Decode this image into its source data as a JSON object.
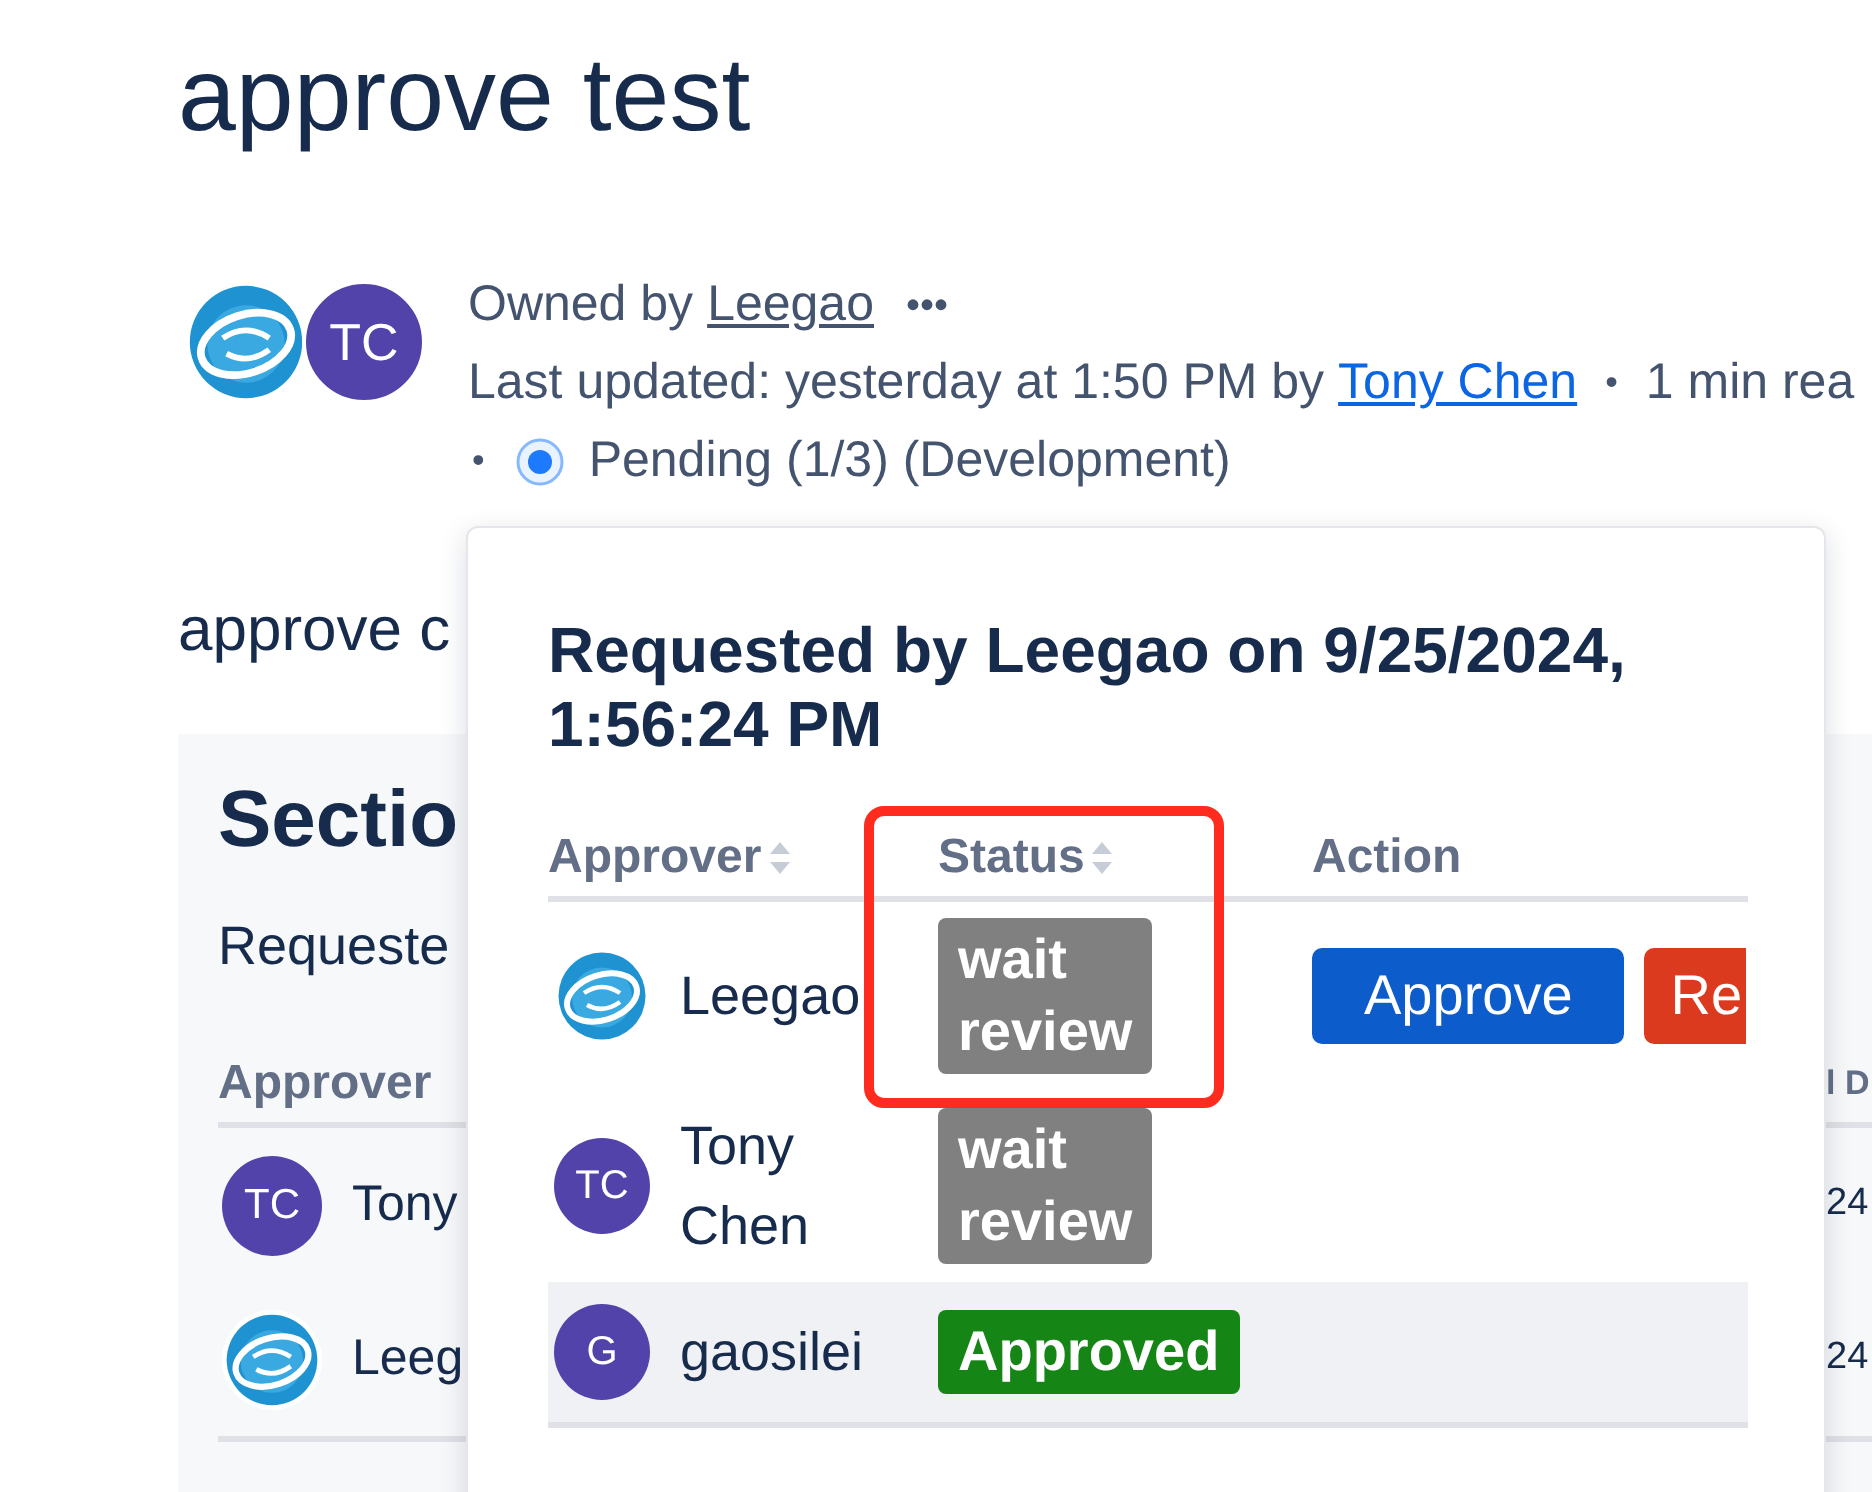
{
  "page_title": "approve test",
  "byline": {
    "avatars": [
      {
        "kind": "logo"
      },
      {
        "kind": "initials",
        "initials": "TC"
      }
    ],
    "owned_label": "Owned by",
    "owner": "Leegao",
    "more_button": "•••",
    "updated_text": "Last updated: yesterday at 1:50 PM by",
    "updated_by": "Tony Chen",
    "separator": "•",
    "read_time": "1 min rea",
    "status_separator": "•",
    "status": "Pending (1/3) (Development)"
  },
  "body_text": "approve c",
  "section": {
    "title": "Sectio",
    "subtitle": "Requeste",
    "columns": [
      "Approver",
      "l D"
    ],
    "rows": [
      {
        "avatar": {
          "kind": "initials",
          "initials": "TC"
        },
        "name": "Tony",
        "column_2": "24"
      },
      {
        "avatar": {
          "kind": "logo"
        },
        "name": "Leeg",
        "column_2": "24"
      }
    ]
  },
  "popover": {
    "title": "Requested by Leegao on 9/25/2024, 1:56:24 PM",
    "columns": [
      {
        "label": "Approver",
        "sortable": true
      },
      {
        "label": "Status",
        "sortable": true
      },
      {
        "label": "Action",
        "sortable": false
      }
    ],
    "rows": [
      {
        "avatar": {
          "kind": "logo"
        },
        "name": "Leegao",
        "status": {
          "label": "wait review",
          "kind": "waiting"
        },
        "actions": [
          {
            "label": "Approve",
            "kind": "approve"
          },
          {
            "label": "Re",
            "kind": "reject"
          }
        ],
        "hovered": false
      },
      {
        "avatar": {
          "kind": "initials",
          "initials": "TC"
        },
        "name": "Tony Chen",
        "status": {
          "label": "wait review",
          "kind": "waiting"
        },
        "hovered": false
      },
      {
        "avatar": {
          "kind": "initials",
          "initials": "G"
        },
        "name": "gaosilei",
        "status": {
          "label": "Approved",
          "kind": "approved"
        },
        "hovered": true
      }
    ]
  }
}
